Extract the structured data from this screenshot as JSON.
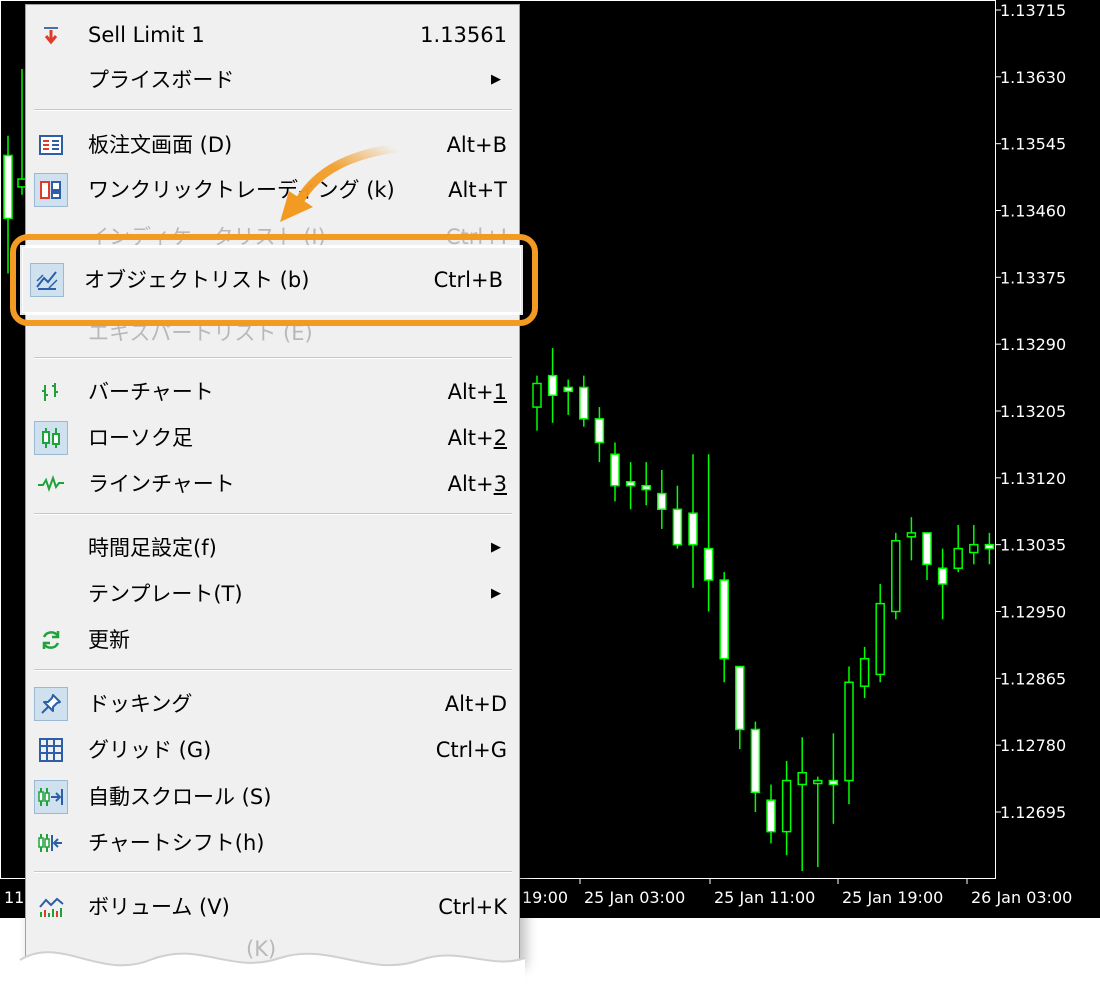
{
  "chart": {
    "price_axis": [
      "1.13715",
      "1.13630",
      "1.13545",
      "1.13460",
      "1.13375",
      "1.13290",
      "1.13205",
      "1.13120",
      "1.13035",
      "1.12950",
      "1.12865",
      "1.12780",
      "1.12695"
    ],
    "time_axis": [
      "11",
      "19:00",
      "25 Jan 03:00",
      "25 Jan 11:00",
      "25 Jan 19:00",
      "26 Jan 03:00"
    ],
    "bull_color": "#00ff00",
    "bear_color": "#ffffff",
    "background": "#000000"
  },
  "chart_data": {
    "type": "candlestick",
    "y_axis_ticks": [
      1.13715,
      1.1363,
      1.13545,
      1.1346,
      1.13375,
      1.1329,
      1.13205,
      1.1312,
      1.13035,
      1.1295,
      1.12865,
      1.1278,
      1.12695
    ],
    "ylim": [
      1.12602,
      1.1372
    ],
    "x_ticks": [
      "11",
      "19:00",
      "25 Jan 03:00",
      "25 Jan 11:00",
      "25 Jan 19:00",
      "26 Jan 03:00"
    ],
    "candles": [
      {
        "o": 1.1353,
        "h": 1.13555,
        "l": 1.1338,
        "c": 1.1345
      },
      {
        "o": 1.1349,
        "h": 1.1364,
        "l": 1.1348,
        "c": 1.135
      },
      {
        "o": 1.1321,
        "h": 1.1325,
        "l": 1.1318,
        "c": 1.1324
      },
      {
        "o": 1.1325,
        "h": 1.13285,
        "l": 1.1319,
        "c": 1.13225
      },
      {
        "o": 1.13235,
        "h": 1.13245,
        "l": 1.132,
        "c": 1.1323
      },
      {
        "o": 1.13235,
        "h": 1.1325,
        "l": 1.13185,
        "c": 1.13195
      },
      {
        "o": 1.13195,
        "h": 1.1321,
        "l": 1.1314,
        "c": 1.13165
      },
      {
        "o": 1.1315,
        "h": 1.13165,
        "l": 1.1309,
        "c": 1.1311
      },
      {
        "o": 1.13115,
        "h": 1.1314,
        "l": 1.1308,
        "c": 1.1311
      },
      {
        "o": 1.1311,
        "h": 1.1314,
        "l": 1.13085,
        "c": 1.13105
      },
      {
        "o": 1.131,
        "h": 1.1313,
        "l": 1.13055,
        "c": 1.1308
      },
      {
        "o": 1.1308,
        "h": 1.1311,
        "l": 1.1303,
        "c": 1.13035
      },
      {
        "o": 1.13075,
        "h": 1.1315,
        "l": 1.1298,
        "c": 1.13035
      },
      {
        "o": 1.1303,
        "h": 1.1315,
        "l": 1.1295,
        "c": 1.1299
      },
      {
        "o": 1.1299,
        "h": 1.13,
        "l": 1.1286,
        "c": 1.1289
      },
      {
        "o": 1.1288,
        "h": 1.1288,
        "l": 1.12775,
        "c": 1.128
      },
      {
        "o": 1.128,
        "h": 1.1281,
        "l": 1.12695,
        "c": 1.1272
      },
      {
        "o": 1.1271,
        "h": 1.1273,
        "l": 1.12655,
        "c": 1.1267
      },
      {
        "o": 1.1267,
        "h": 1.1276,
        "l": 1.1264,
        "c": 1.12735
      },
      {
        "o": 1.1273,
        "h": 1.1279,
        "l": 1.1262,
        "c": 1.12745
      },
      {
        "o": 1.12735,
        "h": 1.1274,
        "l": 1.12625,
        "c": 1.12735
      },
      {
        "o": 1.12735,
        "h": 1.12795,
        "l": 1.1268,
        "c": 1.1273
      },
      {
        "o": 1.12735,
        "h": 1.1288,
        "l": 1.12705,
        "c": 1.1286
      },
      {
        "o": 1.12855,
        "h": 1.12905,
        "l": 1.1284,
        "c": 1.1289
      },
      {
        "o": 1.1287,
        "h": 1.12985,
        "l": 1.1286,
        "c": 1.1296
      },
      {
        "o": 1.1295,
        "h": 1.1305,
        "l": 1.1294,
        "c": 1.1304
      },
      {
        "o": 1.13045,
        "h": 1.1307,
        "l": 1.13015,
        "c": 1.1305
      },
      {
        "o": 1.1305,
        "h": 1.1305,
        "l": 1.1299,
        "c": 1.1301
      },
      {
        "o": 1.13005,
        "h": 1.1303,
        "l": 1.1294,
        "c": 1.12985
      },
      {
        "o": 1.13005,
        "h": 1.1306,
        "l": 1.13,
        "c": 1.1303
      },
      {
        "o": 1.13025,
        "h": 1.1306,
        "l": 1.1301,
        "c": 1.13035
      },
      {
        "o": 1.13035,
        "h": 1.1305,
        "l": 1.1301,
        "c": 1.1303
      }
    ]
  },
  "menu": {
    "items": [
      {
        "key": "sell-limit",
        "label": "Sell Limit 1",
        "shortcut": "1.13561"
      },
      {
        "key": "price-board",
        "label": "プライスボード",
        "submenu": true
      },
      {
        "key": "order-board",
        "label": "板注文画面 (D)",
        "shortcut": "Alt+B"
      },
      {
        "key": "one-click",
        "label": "ワンクリックトレーディング (k)",
        "shortcut": "Alt+T"
      },
      {
        "key": "indicator-list",
        "label": "インディケータリスト (I)",
        "shortcut": "Ctrl+I",
        "disabled": true
      },
      {
        "key": "object-list",
        "label": "オブジェクトリスト (b)",
        "shortcut": "Ctrl+B"
      },
      {
        "key": "expert-list",
        "label": "エキスパートリスト (E)",
        "disabled": true
      },
      {
        "key": "bar-chart",
        "label": "バーチャート",
        "shortcut_prefix": "Alt+",
        "shortcut_key": "1"
      },
      {
        "key": "candlestick",
        "label": "ローソク足",
        "shortcut_prefix": "Alt+",
        "shortcut_key": "2"
      },
      {
        "key": "line-chart",
        "label": "ラインチャート",
        "shortcut_prefix": "Alt+",
        "shortcut_key": "3"
      },
      {
        "key": "timeframe",
        "label": "時間足設定(f)",
        "submenu": true
      },
      {
        "key": "template",
        "label": "テンプレート(T)",
        "submenu": true
      },
      {
        "key": "refresh",
        "label": "更新"
      },
      {
        "key": "docking",
        "label": "ドッキング",
        "shortcut": "Alt+D"
      },
      {
        "key": "grid",
        "label": "グリッド (G)",
        "shortcut": "Ctrl+G"
      },
      {
        "key": "autoscroll",
        "label": "自動スクロール (S)"
      },
      {
        "key": "chart-shift",
        "label": "チャートシフト(h)"
      },
      {
        "key": "volume",
        "label": "ボリューム (V)",
        "shortcut": "Ctrl+K"
      },
      {
        "key": "cut-off",
        "label": "(K)",
        "disabled": true
      }
    ],
    "arrow_glyph": "▶"
  },
  "callout": {
    "color": "#f29a22"
  }
}
